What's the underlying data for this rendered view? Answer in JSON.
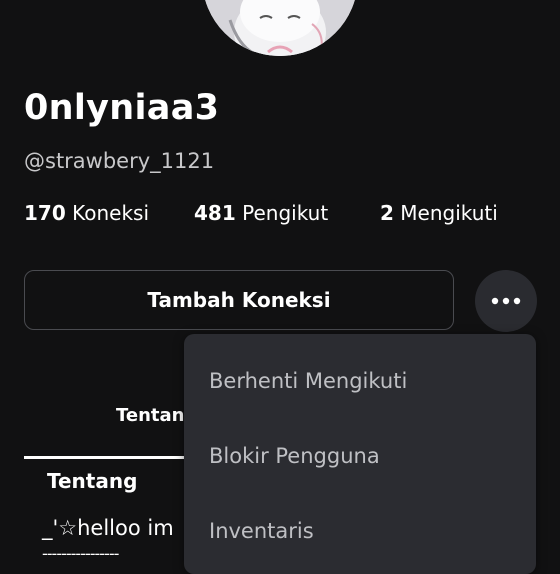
{
  "profile": {
    "display_name": "0nlyniaa3",
    "username": "@strawbery_1121"
  },
  "stats": [
    {
      "count": "170",
      "label": "Koneksi"
    },
    {
      "count": "481",
      "label": "Pengikut"
    },
    {
      "count": "2",
      "label": "Mengikuti"
    }
  ],
  "actions": {
    "add_connection": "Tambah Koneksi",
    "more_icon": "more-horizontal-icon"
  },
  "tabs": {
    "about": "Tentang"
  },
  "about": {
    "title": "Tentang",
    "text": "_'☆helloo im",
    "divider": "----------------"
  },
  "menu": {
    "items": [
      "Berhenti Mengikuti",
      "Blokir Pengguna",
      "Inventaris"
    ]
  },
  "colors": {
    "background": "#111112",
    "menu_background": "#2b2c31",
    "button_border": "#4a4b50"
  }
}
